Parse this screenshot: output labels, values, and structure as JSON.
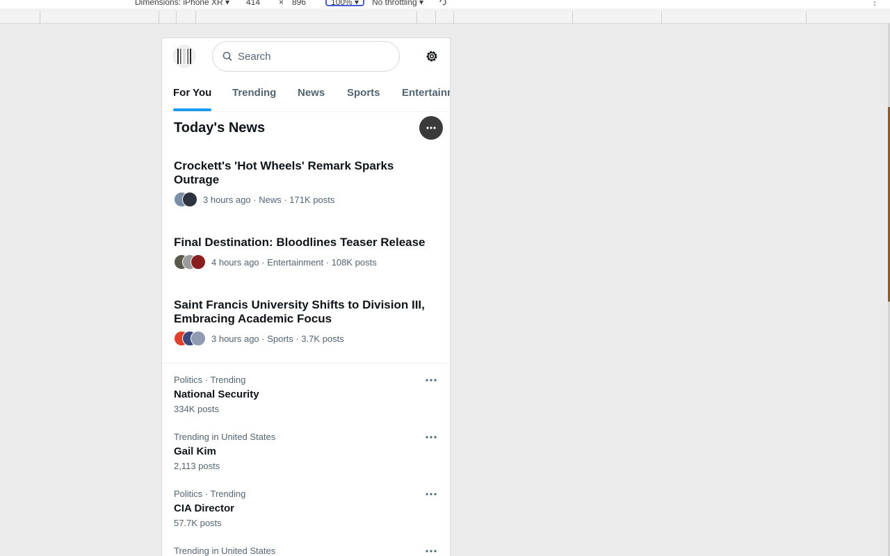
{
  "devtools": {
    "dimensions_label": "Dimensions: iPhone XR ▾",
    "width": "414",
    "times": "×",
    "height": "896",
    "zoom": "100% ▾",
    "throttling": "No throttling ▾"
  },
  "colors": {
    "accent": "#1d9bf0",
    "text_primary": "#0f1419",
    "text_secondary": "#536471"
  },
  "header": {
    "logo_icon": "film-reel-icon",
    "search_placeholder": "Search",
    "settings_icon": "gear-icon"
  },
  "tabs": [
    {
      "label": "For You",
      "active": true
    },
    {
      "label": "Trending",
      "active": false
    },
    {
      "label": "News",
      "active": false
    },
    {
      "label": "Sports",
      "active": false
    },
    {
      "label": "Entertainment",
      "active": false
    }
  ],
  "todays_news": {
    "heading": "Today's News",
    "stories": [
      {
        "title": "Crockett's 'Hot Wheels' Remark Sparks Outrage",
        "meta": "3 hours ago · News · 171K posts",
        "avatar_colors": [
          "#7a8fa6",
          "#2e3340"
        ]
      },
      {
        "title": "Final Destination: Bloodlines Teaser Release",
        "meta": "4 hours ago · Entertainment · 108K posts",
        "avatar_colors": [
          "#5b5a4a",
          "#9a9a9a",
          "#8a1e1e"
        ]
      },
      {
        "title": "Saint Francis University Shifts to Division III, Embracing Academic Focus",
        "meta": "3 hours ago · Sports · 3.7K posts",
        "avatar_colors": [
          "#e0412b",
          "#3b4a7a",
          "#8f9bb0"
        ]
      }
    ]
  },
  "trends": [
    {
      "context": "Politics · Trending",
      "name": "National Security",
      "count": "334K posts"
    },
    {
      "context": "Trending in United States",
      "name": "Gail Kim",
      "count": "2,113 posts"
    },
    {
      "context": "Politics · Trending",
      "name": "CIA Director",
      "count": "57.7K posts"
    },
    {
      "context": "Trending in United States",
      "name": "",
      "count": ""
    }
  ]
}
